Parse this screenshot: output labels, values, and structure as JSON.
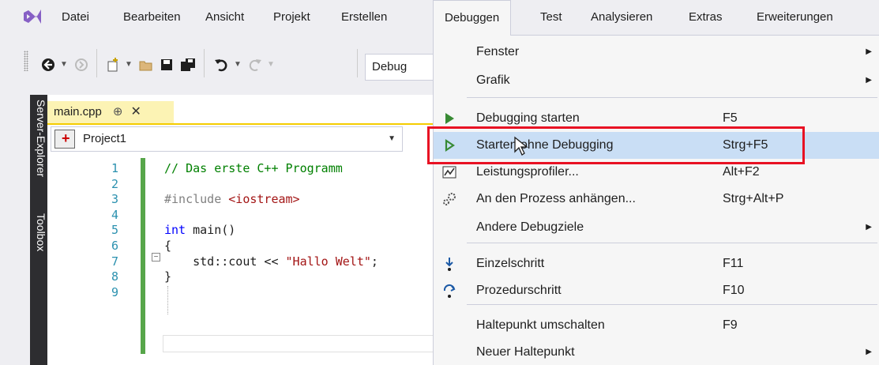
{
  "menubar": {
    "items": [
      "Datei",
      "Bearbeiten",
      "Ansicht",
      "Projekt",
      "Erstellen",
      "Debuggen",
      "Test",
      "Analysieren",
      "Extras",
      "Erweiterungen"
    ],
    "active": "Debuggen"
  },
  "toolbar": {
    "config": "Debug"
  },
  "sidetabs": [
    "Server-Explorer",
    "Toolbox"
  ],
  "editor": {
    "tab_name": "main.cpp",
    "pin_glyph": "⊕",
    "close_glyph": "✕",
    "project": "Project1",
    "line_numbers": [
      "1",
      "2",
      "3",
      "4",
      "5",
      "6",
      "7",
      "8",
      "9"
    ],
    "lines": [
      {
        "parts": [
          {
            "t": "// Das erste C++ Programm",
            "c": "cmt"
          }
        ]
      },
      {
        "parts": []
      },
      {
        "parts": [
          {
            "t": "#include ",
            "c": "pp"
          },
          {
            "t": "<iostream>",
            "c": "str"
          }
        ]
      },
      {
        "parts": []
      },
      {
        "parts": [
          {
            "t": "int",
            "c": "kw"
          },
          {
            "t": " main()",
            "c": ""
          }
        ]
      },
      {
        "parts": [
          {
            "t": "{",
            "c": ""
          }
        ]
      },
      {
        "parts": [
          {
            "t": "    std::cout << ",
            "c": ""
          },
          {
            "t": "\"Hallo Welt\"",
            "c": "str"
          },
          {
            "t": ";",
            "c": ""
          }
        ]
      },
      {
        "parts": [
          {
            "t": "}",
            "c": ""
          }
        ]
      },
      {
        "parts": []
      }
    ]
  },
  "dropdown": {
    "items": [
      {
        "label": "Fenster",
        "shortcut": "",
        "submenu": true,
        "icon": ""
      },
      {
        "label": "Grafik",
        "shortcut": "",
        "submenu": true,
        "icon": ""
      },
      {
        "label": "Debugging starten",
        "shortcut": "F5",
        "submenu": false,
        "icon": "play-filled-icon"
      },
      {
        "label": "Starten ohne Debugging",
        "shortcut": "Strg+F5",
        "submenu": false,
        "icon": "play-outline-icon"
      },
      {
        "label": "Leistungsprofiler...",
        "shortcut": "Alt+F2",
        "submenu": false,
        "icon": "profiler-icon"
      },
      {
        "label": "An den Prozess anhängen...",
        "shortcut": "Strg+Alt+P",
        "submenu": false,
        "icon": "attach-process-icon"
      },
      {
        "label": "Andere Debugziele",
        "shortcut": "",
        "submenu": true,
        "icon": ""
      },
      {
        "label": "Einzelschritt",
        "shortcut": "F11",
        "submenu": false,
        "icon": "step-into-icon"
      },
      {
        "label": "Prozedurschritt",
        "shortcut": "F10",
        "submenu": false,
        "icon": "step-over-icon"
      },
      {
        "label": "Haltepunkt umschalten",
        "shortcut": "F9",
        "submenu": false,
        "icon": ""
      },
      {
        "label": "Neuer Haltepunkt",
        "shortcut": "",
        "submenu": true,
        "icon": ""
      }
    ],
    "highlighted": "Starten ohne Debugging"
  },
  "colors": {
    "accent_green": "#2e8b3a",
    "highlight": "#c9def5",
    "callout_red": "#e81123",
    "tab_yellow": "#fcf3b4"
  }
}
